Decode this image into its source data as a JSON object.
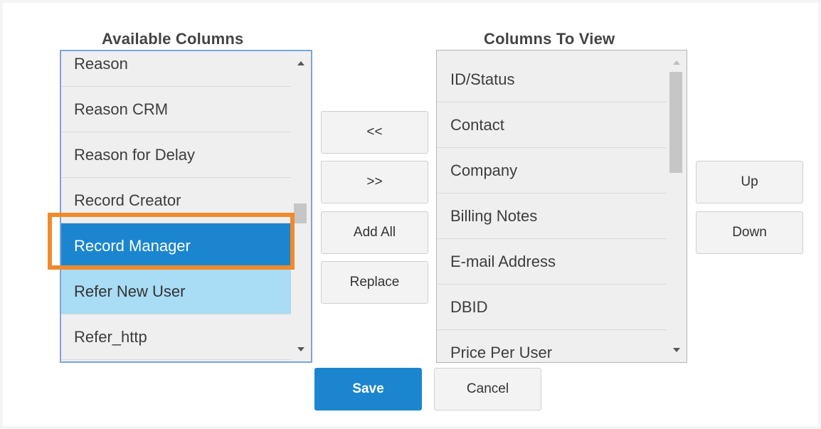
{
  "columns_dialog": {
    "available_title": "Available Columns",
    "view_title": "Columns To View",
    "available_items": [
      {
        "label": "Reason",
        "state": "normal"
      },
      {
        "label": "Reason CRM",
        "state": "normal"
      },
      {
        "label": "Reason for Delay",
        "state": "normal"
      },
      {
        "label": "Record Creator",
        "state": "normal"
      },
      {
        "label": "Record Manager",
        "state": "selected"
      },
      {
        "label": "Refer New User",
        "state": "hover"
      },
      {
        "label": "Refer_http",
        "state": "normal"
      }
    ],
    "view_items": [
      {
        "label": "ID/Status"
      },
      {
        "label": "Contact"
      },
      {
        "label": "Company"
      },
      {
        "label": "Billing Notes"
      },
      {
        "label": "E-mail Address"
      },
      {
        "label": "DBID"
      },
      {
        "label": "Price Per User"
      }
    ],
    "buttons": {
      "remove": "<<",
      "add": ">>",
      "add_all": "Add All",
      "replace": "Replace",
      "up": "Up",
      "down": "Down",
      "save": "Save",
      "cancel": "Cancel"
    },
    "highlighted_item": "Record Manager",
    "colors": {
      "selected_bg": "#1b86cf",
      "hover_bg": "#a9dcf5",
      "highlight_border": "#f08a2c",
      "list_border": "#7aa6d8"
    },
    "icons": {
      "scroll_up": "scroll-up-arrow-icon",
      "scroll_down": "scroll-down-arrow-icon"
    }
  }
}
